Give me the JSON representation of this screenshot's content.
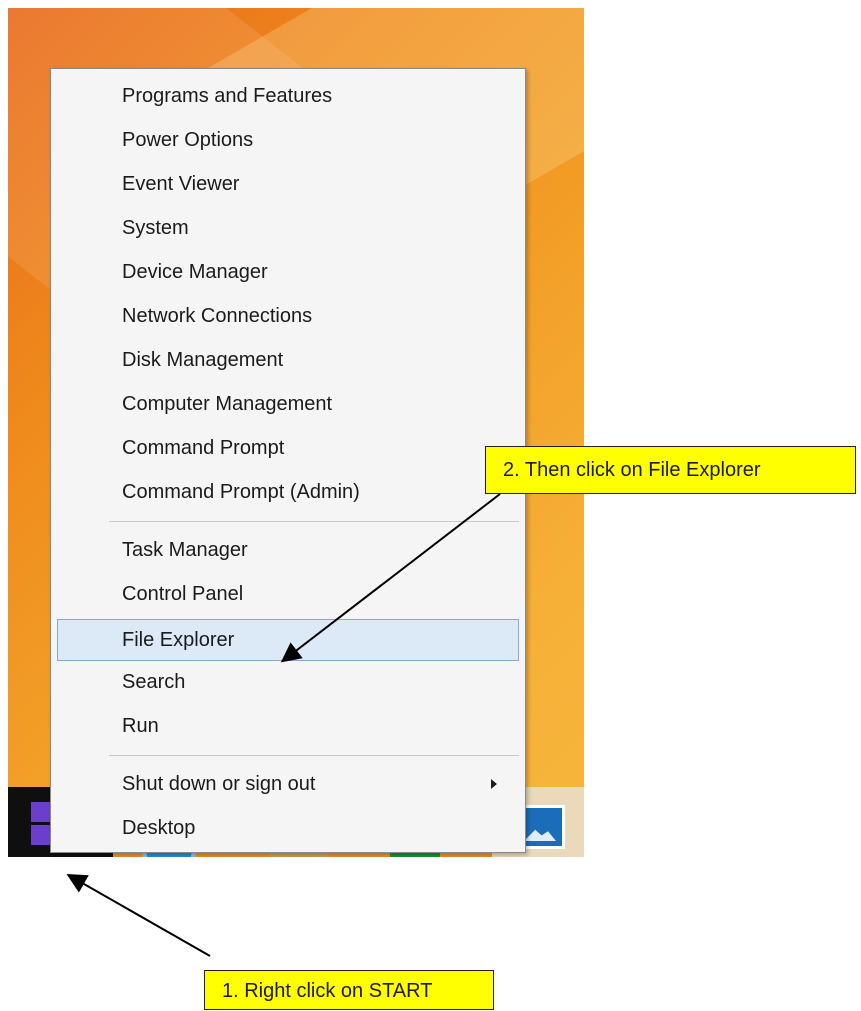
{
  "menu": {
    "items": [
      {
        "label": "Programs and Features"
      },
      {
        "label": "Power Options"
      },
      {
        "label": "Event Viewer"
      },
      {
        "label": "System"
      },
      {
        "label": "Device Manager"
      },
      {
        "label": "Network Connections"
      },
      {
        "label": "Disk Management"
      },
      {
        "label": "Computer Management"
      },
      {
        "label": "Command Prompt"
      },
      {
        "label": "Command Prompt (Admin)"
      },
      {
        "label": "Task Manager"
      },
      {
        "label": "Control Panel"
      },
      {
        "label": "File Explorer",
        "highlighted": true
      },
      {
        "label": "Search"
      },
      {
        "label": "Run"
      },
      {
        "label": "Shut down or sign out",
        "submenu": true
      },
      {
        "label": "Desktop"
      }
    ]
  },
  "callouts": {
    "step2": "2. Then click on File Explorer",
    "step1": "1. Right click on START"
  },
  "taskbar": {
    "icons": [
      "start-icon",
      "internet-explorer-icon",
      "file-explorer-icon",
      "store-icon",
      "photos-icon"
    ]
  },
  "colors": {
    "callout": "#ffff00",
    "menu_bg": "#f5f5f5",
    "highlight": "#dce9f6",
    "start_tiles": "#6a3fc9"
  }
}
